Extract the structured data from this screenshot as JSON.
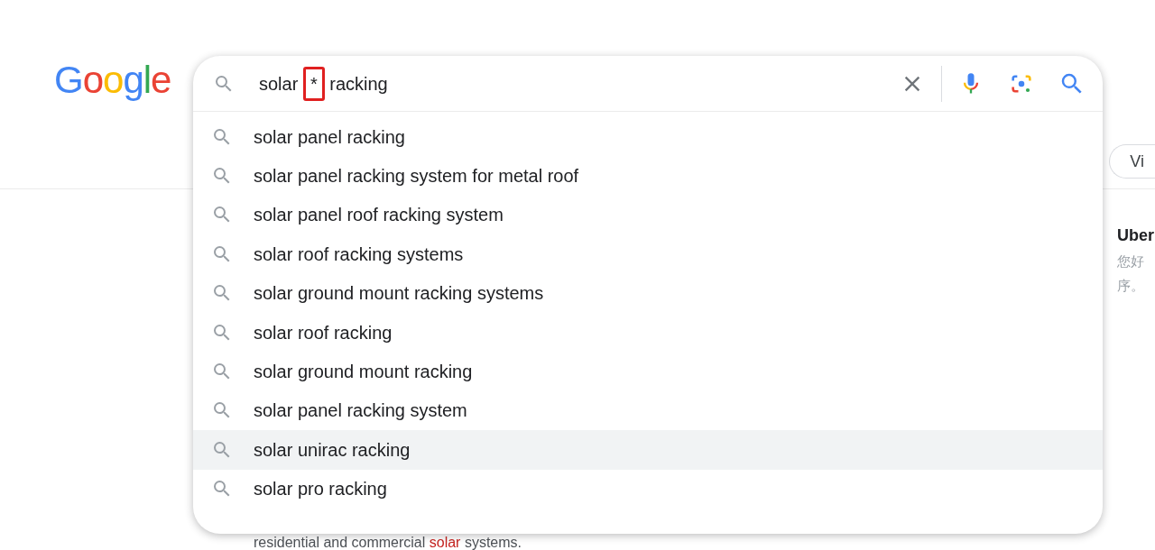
{
  "logo": {
    "letters": [
      {
        "text": "G",
        "color": "#4285f4"
      },
      {
        "text": "o",
        "color": "#ea4335"
      },
      {
        "text": "o",
        "color": "#fbbc05"
      },
      {
        "text": "g",
        "color": "#4285f4"
      },
      {
        "text": "l",
        "color": "#34a853"
      },
      {
        "text": "e",
        "color": "#ea4335"
      }
    ]
  },
  "search": {
    "query_parts": [
      {
        "text": "solar ",
        "marked": false
      },
      {
        "text": "*",
        "marked": true
      },
      {
        "text": " racking",
        "marked": false
      }
    ]
  },
  "suggestions": [
    {
      "text": "solar panel racking",
      "selected": false
    },
    {
      "text": "solar panel racking system for metal roof",
      "selected": false
    },
    {
      "text": "solar panel roof racking system",
      "selected": false
    },
    {
      "text": "solar roof racking systems",
      "selected": false
    },
    {
      "text": "solar ground mount racking systems",
      "selected": false
    },
    {
      "text": "solar roof racking",
      "selected": false
    },
    {
      "text": "solar ground mount racking",
      "selected": false
    },
    {
      "text": "solar panel racking system",
      "selected": false
    },
    {
      "text": "solar unirac racking",
      "selected": true
    },
    {
      "text": "solar pro racking",
      "selected": false
    }
  ],
  "chip": "Vi",
  "side_card": {
    "title": "Uber",
    "lines": [
      "您好",
      "序。"
    ]
  },
  "result_snippet": {
    "parts": [
      {
        "text": "residential and commercial ",
        "match": false
      },
      {
        "text": "solar",
        "match": true
      },
      {
        "text": " systems.",
        "match": false
      }
    ]
  }
}
